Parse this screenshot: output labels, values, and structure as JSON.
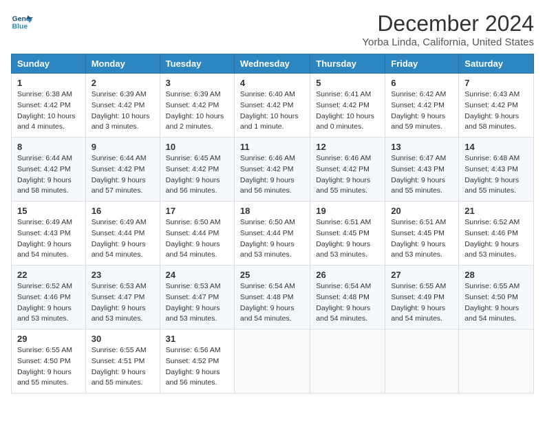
{
  "logo": {
    "line1": "General",
    "line2": "Blue"
  },
  "title": "December 2024",
  "location": "Yorba Linda, California, United States",
  "weekdays": [
    "Sunday",
    "Monday",
    "Tuesday",
    "Wednesday",
    "Thursday",
    "Friday",
    "Saturday"
  ],
  "weeks": [
    [
      {
        "day": "1",
        "sunrise": "6:38 AM",
        "sunset": "4:42 PM",
        "daylight": "10 hours and 4 minutes."
      },
      {
        "day": "2",
        "sunrise": "6:39 AM",
        "sunset": "4:42 PM",
        "daylight": "10 hours and 3 minutes."
      },
      {
        "day": "3",
        "sunrise": "6:39 AM",
        "sunset": "4:42 PM",
        "daylight": "10 hours and 2 minutes."
      },
      {
        "day": "4",
        "sunrise": "6:40 AM",
        "sunset": "4:42 PM",
        "daylight": "10 hours and 1 minute."
      },
      {
        "day": "5",
        "sunrise": "6:41 AM",
        "sunset": "4:42 PM",
        "daylight": "10 hours and 0 minutes."
      },
      {
        "day": "6",
        "sunrise": "6:42 AM",
        "sunset": "4:42 PM",
        "daylight": "9 hours and 59 minutes."
      },
      {
        "day": "7",
        "sunrise": "6:43 AM",
        "sunset": "4:42 PM",
        "daylight": "9 hours and 58 minutes."
      }
    ],
    [
      {
        "day": "8",
        "sunrise": "6:44 AM",
        "sunset": "4:42 PM",
        "daylight": "9 hours and 58 minutes."
      },
      {
        "day": "9",
        "sunrise": "6:44 AM",
        "sunset": "4:42 PM",
        "daylight": "9 hours and 57 minutes."
      },
      {
        "day": "10",
        "sunrise": "6:45 AM",
        "sunset": "4:42 PM",
        "daylight": "9 hours and 56 minutes."
      },
      {
        "day": "11",
        "sunrise": "6:46 AM",
        "sunset": "4:42 PM",
        "daylight": "9 hours and 56 minutes."
      },
      {
        "day": "12",
        "sunrise": "6:46 AM",
        "sunset": "4:42 PM",
        "daylight": "9 hours and 55 minutes."
      },
      {
        "day": "13",
        "sunrise": "6:47 AM",
        "sunset": "4:43 PM",
        "daylight": "9 hours and 55 minutes."
      },
      {
        "day": "14",
        "sunrise": "6:48 AM",
        "sunset": "4:43 PM",
        "daylight": "9 hours and 55 minutes."
      }
    ],
    [
      {
        "day": "15",
        "sunrise": "6:49 AM",
        "sunset": "4:43 PM",
        "daylight": "9 hours and 54 minutes."
      },
      {
        "day": "16",
        "sunrise": "6:49 AM",
        "sunset": "4:44 PM",
        "daylight": "9 hours and 54 minutes."
      },
      {
        "day": "17",
        "sunrise": "6:50 AM",
        "sunset": "4:44 PM",
        "daylight": "9 hours and 54 minutes."
      },
      {
        "day": "18",
        "sunrise": "6:50 AM",
        "sunset": "4:44 PM",
        "daylight": "9 hours and 53 minutes."
      },
      {
        "day": "19",
        "sunrise": "6:51 AM",
        "sunset": "4:45 PM",
        "daylight": "9 hours and 53 minutes."
      },
      {
        "day": "20",
        "sunrise": "6:51 AM",
        "sunset": "4:45 PM",
        "daylight": "9 hours and 53 minutes."
      },
      {
        "day": "21",
        "sunrise": "6:52 AM",
        "sunset": "4:46 PM",
        "daylight": "9 hours and 53 minutes."
      }
    ],
    [
      {
        "day": "22",
        "sunrise": "6:52 AM",
        "sunset": "4:46 PM",
        "daylight": "9 hours and 53 minutes."
      },
      {
        "day": "23",
        "sunrise": "6:53 AM",
        "sunset": "4:47 PM",
        "daylight": "9 hours and 53 minutes."
      },
      {
        "day": "24",
        "sunrise": "6:53 AM",
        "sunset": "4:47 PM",
        "daylight": "9 hours and 53 minutes."
      },
      {
        "day": "25",
        "sunrise": "6:54 AM",
        "sunset": "4:48 PM",
        "daylight": "9 hours and 54 minutes."
      },
      {
        "day": "26",
        "sunrise": "6:54 AM",
        "sunset": "4:48 PM",
        "daylight": "9 hours and 54 minutes."
      },
      {
        "day": "27",
        "sunrise": "6:55 AM",
        "sunset": "4:49 PM",
        "daylight": "9 hours and 54 minutes."
      },
      {
        "day": "28",
        "sunrise": "6:55 AM",
        "sunset": "4:50 PM",
        "daylight": "9 hours and 54 minutes."
      }
    ],
    [
      {
        "day": "29",
        "sunrise": "6:55 AM",
        "sunset": "4:50 PM",
        "daylight": "9 hours and 55 minutes."
      },
      {
        "day": "30",
        "sunrise": "6:55 AM",
        "sunset": "4:51 PM",
        "daylight": "9 hours and 55 minutes."
      },
      {
        "day": "31",
        "sunrise": "6:56 AM",
        "sunset": "4:52 PM",
        "daylight": "9 hours and 56 minutes."
      },
      null,
      null,
      null,
      null
    ]
  ],
  "labels": {
    "sunrise": "Sunrise:",
    "sunset": "Sunset:",
    "daylight": "Daylight:"
  }
}
